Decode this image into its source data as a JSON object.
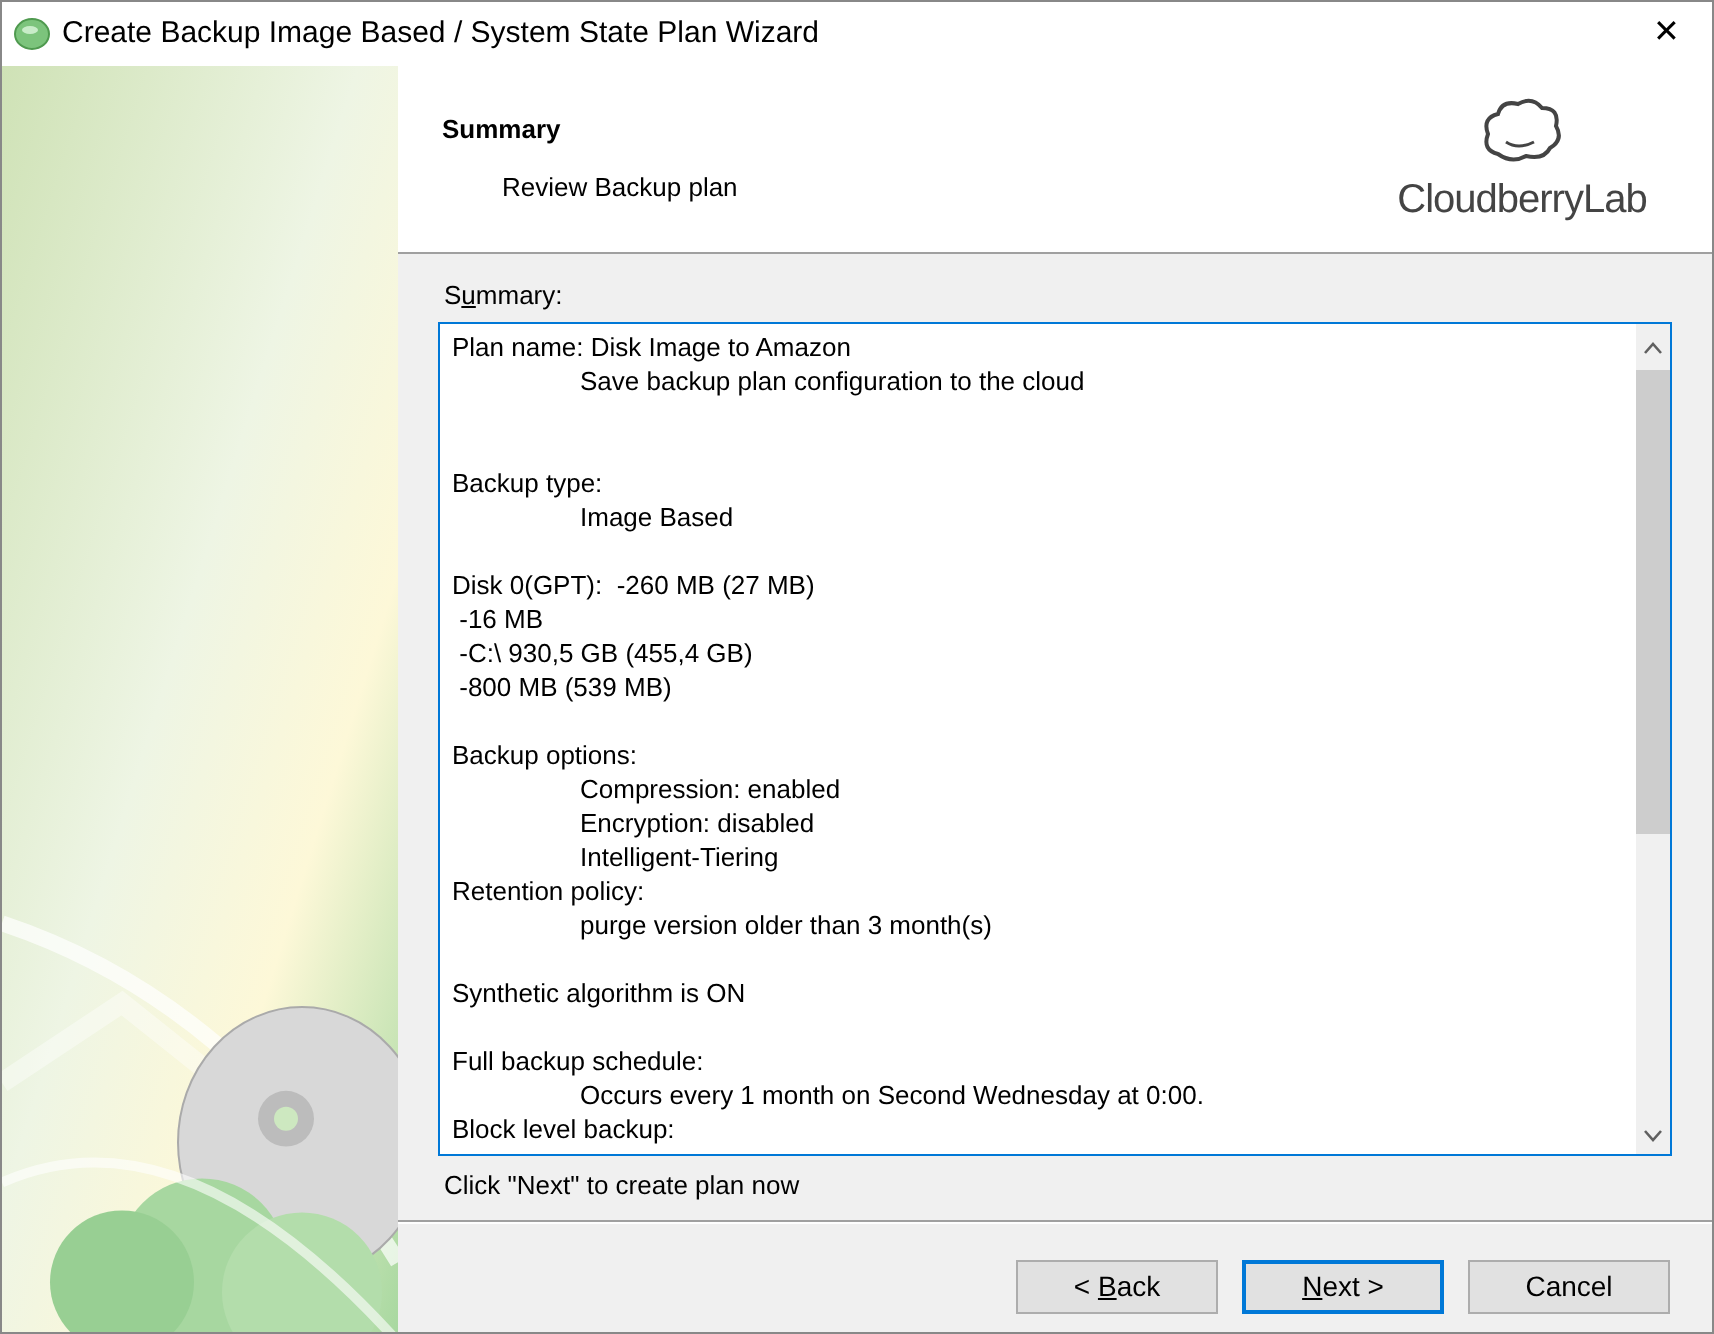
{
  "window": {
    "title": "Create Backup Image Based / System State Plan Wizard",
    "close": "✕"
  },
  "header": {
    "title": "Summary",
    "subtitle": "Review Backup plan",
    "logo_text": "CloudberryLab"
  },
  "summary": {
    "label": [
      {
        "text": "S",
        "underlined": false
      },
      {
        "text": "u",
        "underlined": true
      },
      {
        "text": "mmary:",
        "underlined": false
      }
    ],
    "lines": [
      {
        "kind": "plain",
        "text": "Plan name: Disk Image to Amazon"
      },
      {
        "kind": "indented",
        "text": "Save backup plan configuration to the cloud"
      },
      {
        "kind": "blank"
      },
      {
        "kind": "blank"
      },
      {
        "kind": "plain",
        "text": "Backup type:"
      },
      {
        "kind": "indented",
        "text": "Image Based"
      },
      {
        "kind": "blank"
      },
      {
        "kind": "plain",
        "text": "Disk 0(GPT):  -260 MB (27 MB)"
      },
      {
        "kind": "plain",
        "text": " -16 MB"
      },
      {
        "kind": "plain",
        "text": " -C:\\ 930,5 GB (455,4 GB)"
      },
      {
        "kind": "plain",
        "text": " -800 MB (539 MB)"
      },
      {
        "kind": "blank"
      },
      {
        "kind": "plain",
        "text": "Backup options:"
      },
      {
        "kind": "indented",
        "text": "Compression: enabled"
      },
      {
        "kind": "indented",
        "text": "Encryption: disabled"
      },
      {
        "kind": "indented",
        "text": "Intelligent-Tiering"
      },
      {
        "kind": "plain",
        "text": "Retention policy:"
      },
      {
        "kind": "indented",
        "text": "purge version older than 3 month(s)"
      },
      {
        "kind": "blank"
      },
      {
        "kind": "plain",
        "text": "Synthetic algorithm is ON"
      },
      {
        "kind": "blank"
      },
      {
        "kind": "plain",
        "text": "Full backup schedule:"
      },
      {
        "kind": "indented",
        "text": "Occurs every 1 month on Second Wednesday at 0:00."
      },
      {
        "kind": "plain",
        "text": "Block level backup:"
      }
    ]
  },
  "hint": "Click \"Next\" to create plan now",
  "buttons": [
    {
      "label": [
        {
          "text": "< ",
          "underlined": false
        },
        {
          "text": "B",
          "underlined": true
        },
        {
          "text": "ack",
          "underlined": false
        }
      ],
      "selected": false
    },
    {
      "label": [
        {
          "text": "N",
          "underlined": true
        },
        {
          "text": "ext >",
          "underlined": false
        }
      ],
      "selected": true
    },
    {
      "label": [
        {
          "text": "Cancel",
          "underlined": false
        }
      ],
      "selected": false
    }
  ]
}
